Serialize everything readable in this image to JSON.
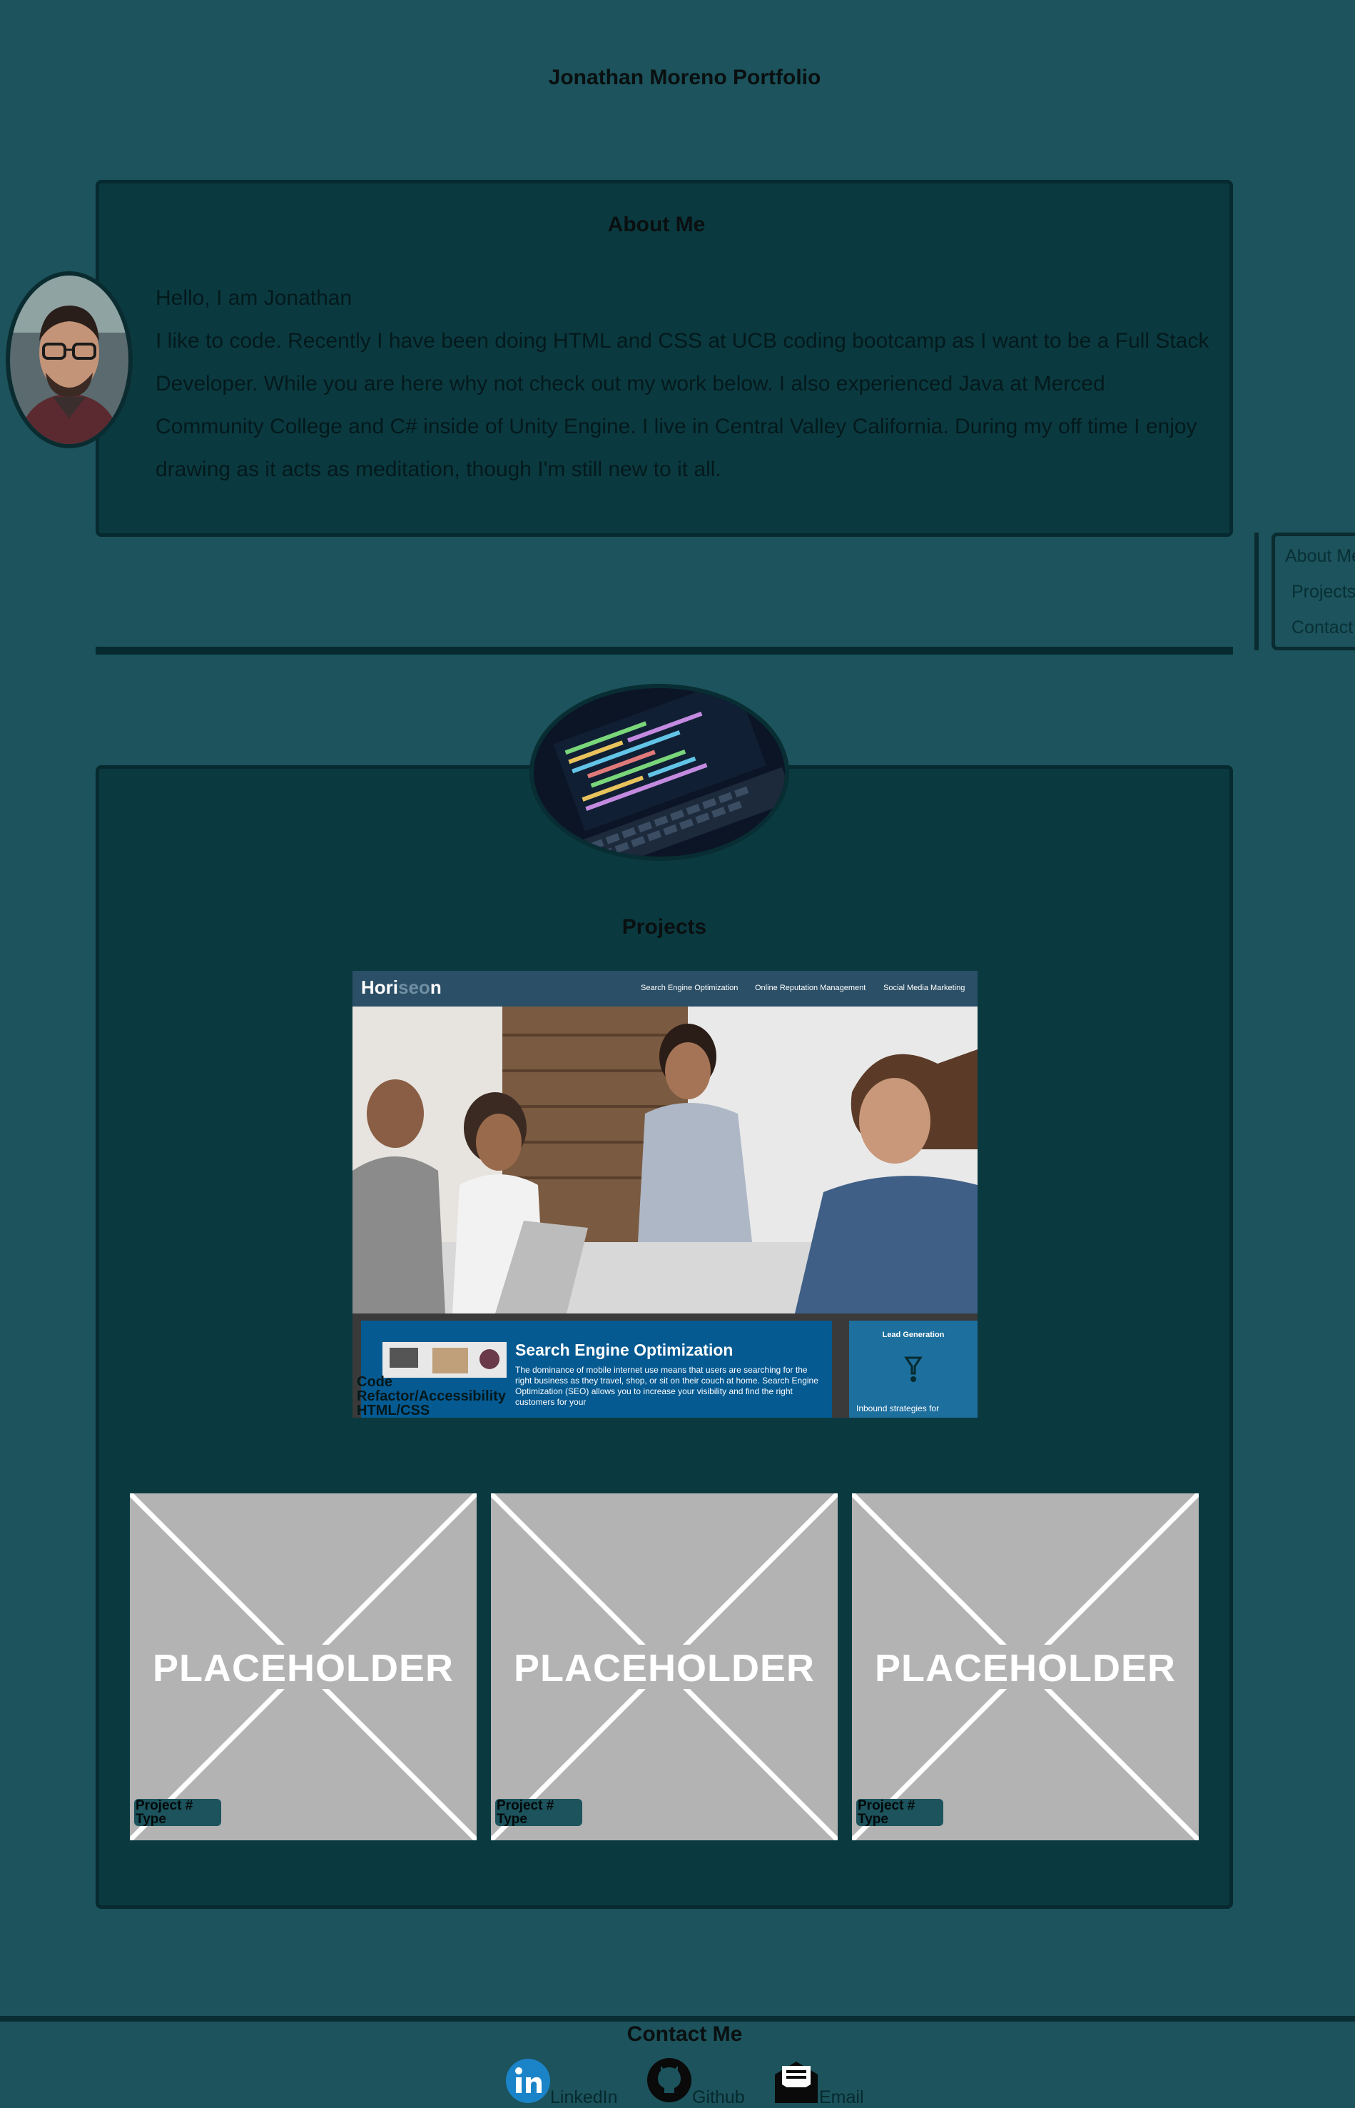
{
  "site": {
    "title": "Jonathan Moreno Portfolio"
  },
  "about": {
    "heading": "About Me",
    "greeting": "Hello, I am Jonathan",
    "body": "I like to code. Recently I have been doing HTML and CSS at UCB coding bootcamp as I want to be a Full Stack Developer. While you are here why not check out my work below. I also experienced Java at Merced Community College and C# inside of Unity Engine. I live in Central Valley California. During my off time I enjoy drawing as it acts as meditation, though I'm still new to it all."
  },
  "nav": {
    "items": [
      "About Me",
      "Projects",
      "Contact"
    ]
  },
  "projects": {
    "heading": "Projects",
    "featured": {
      "brand_a": "Hori",
      "brand_b": "seo",
      "brand_c": "n",
      "nav": [
        "Search Engine Optimization",
        "Online Reputation Management",
        "Social Media Marketing"
      ],
      "card_title": "Search Engine Optimization",
      "card_text": "The dominance of mobile internet use means that users are searching for the right business as they travel, shop, or sit on their couch at home. Search Engine Optimization (SEO) allows you to increase your visibility and find the right customers for your",
      "side_title": "Lead Generation",
      "side_text": "Inbound strategies for",
      "caption_line1": "Code",
      "caption_line2": "Refactor/Accessibility",
      "caption_line3": "HTML/CSS"
    },
    "placeholders": [
      {
        "text": "PLACEHOLDER",
        "line1": "Project #",
        "line2": "Type"
      },
      {
        "text": "PLACEHOLDER",
        "line1": "Project #",
        "line2": "Type"
      },
      {
        "text": "PLACEHOLDER",
        "line1": "Project #",
        "line2": "Type"
      }
    ]
  },
  "contact": {
    "heading": "Contact Me",
    "links": [
      {
        "label": "LinkedIn",
        "icon": "linkedin-icon"
      },
      {
        "label": "Github",
        "icon": "github-icon"
      },
      {
        "label": "Email",
        "icon": "email-icon"
      }
    ]
  },
  "colors": {
    "page_bg": "#1c535c",
    "panel_bg": "#0a3a40",
    "panel_border": "#062a2f",
    "linkedin": "#1b84c9",
    "placeholder_bg": "#b3b3b3"
  }
}
